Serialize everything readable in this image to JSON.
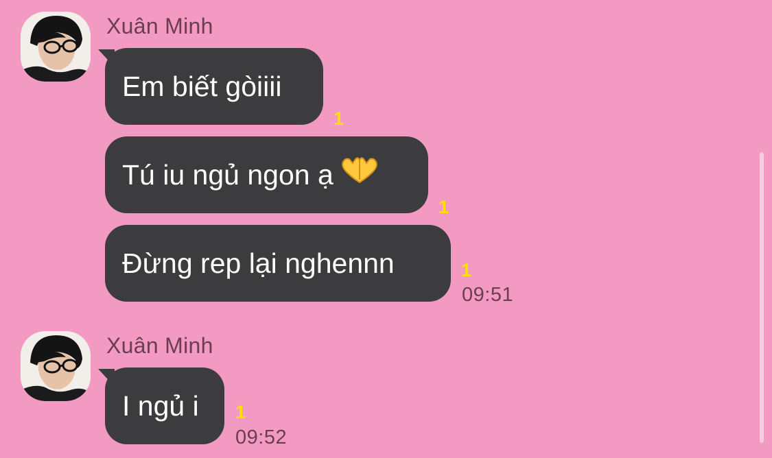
{
  "groups": [
    {
      "sender": "Xuân Minh",
      "messages": [
        {
          "text": "Em biết gòiiii",
          "read_count": "1"
        },
        {
          "text": "Tú iu ngủ ngon ạ",
          "emoji": "heart-hands",
          "read_count": "1"
        },
        {
          "text": "Đừng rep lại nghennn",
          "read_count": "1",
          "time": "09:51"
        }
      ]
    },
    {
      "sender": "Xuân Minh",
      "messages": [
        {
          "text": "I ngủ i",
          "read_count": "1",
          "time": "09:52"
        }
      ]
    }
  ],
  "colors": {
    "background": "#f39ac3",
    "bubble": "#3c3c3e",
    "read_count": "#ffe000",
    "name_and_time": "#6b3d55"
  }
}
